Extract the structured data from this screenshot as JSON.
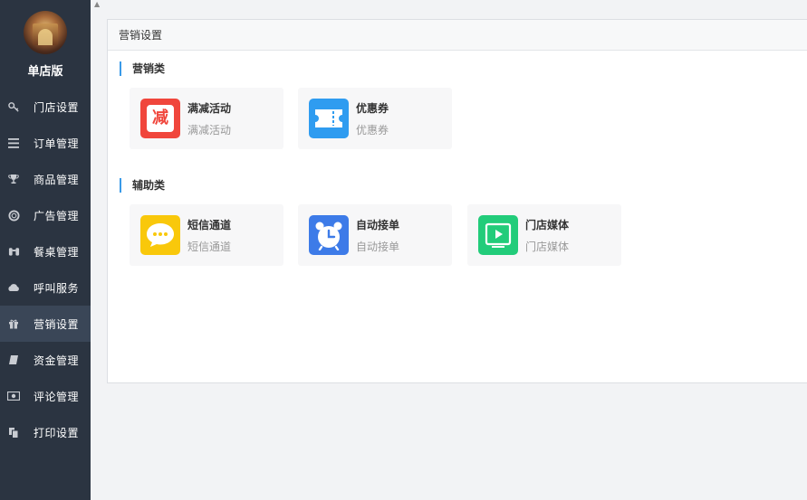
{
  "shop": {
    "name": "单店版"
  },
  "nav": [
    {
      "label": "门店设置",
      "icon": "key-icon"
    },
    {
      "label": "订单管理",
      "icon": "list-icon"
    },
    {
      "label": "商品管理",
      "icon": "trophy-icon"
    },
    {
      "label": "广告管理",
      "icon": "lifebuoy-icon"
    },
    {
      "label": "餐桌管理",
      "icon": "binoculars-icon"
    },
    {
      "label": "呼叫服务",
      "icon": "cloud-icon"
    },
    {
      "label": "营销设置",
      "icon": "gift-icon",
      "active": true
    },
    {
      "label": "资金管理",
      "icon": "book-icon"
    },
    {
      "label": "评论管理",
      "icon": "money-icon"
    },
    {
      "label": "打印设置",
      "icon": "copy-icon"
    }
  ],
  "panel": {
    "title": "营销设置"
  },
  "sections": {
    "marketing": {
      "title": "营销类",
      "cards": [
        {
          "title": "满减活动",
          "subtitle": "满减活动",
          "icon": "discount-icon",
          "color": "#f0463c",
          "glyph": "减"
        },
        {
          "title": "优惠券",
          "subtitle": "优惠券",
          "icon": "coupon-icon",
          "color": "#2f9cf0"
        }
      ]
    },
    "auxiliary": {
      "title": "辅助类",
      "cards": [
        {
          "title": "短信通道",
          "subtitle": "短信通道",
          "icon": "message-icon",
          "color": "#f9c80b"
        },
        {
          "title": "自动接单",
          "subtitle": "自动接单",
          "icon": "alarm-clock-icon",
          "color": "#3d7be8"
        },
        {
          "title": "门店媒体",
          "subtitle": "门店媒体",
          "icon": "media-play-icon",
          "color": "#22cc7a"
        }
      ]
    }
  }
}
